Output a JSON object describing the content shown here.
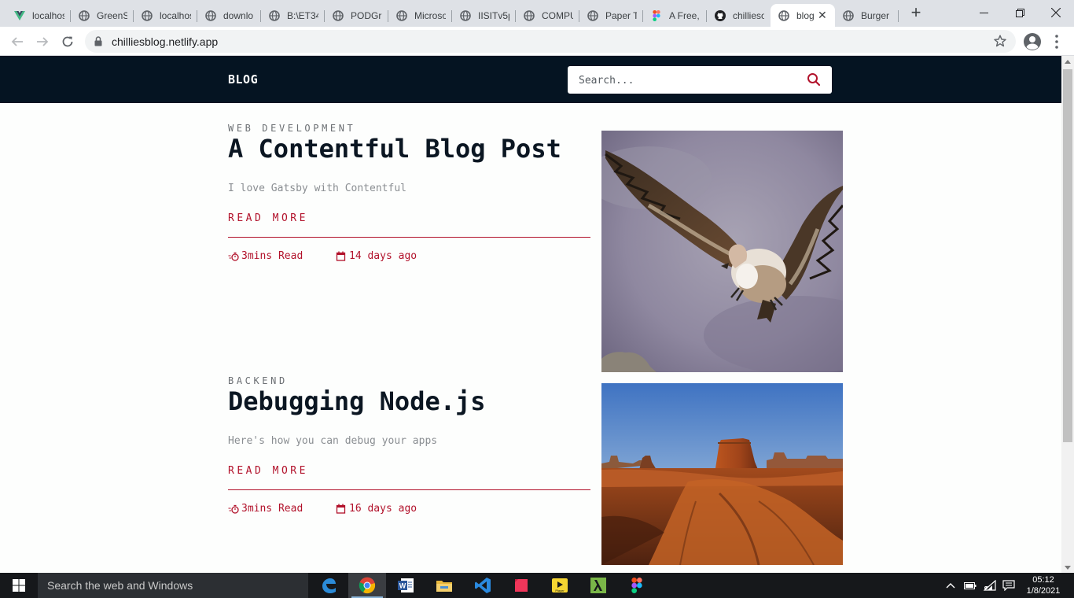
{
  "browser": {
    "tabs": [
      {
        "title": "localhos",
        "favicon": "vue-icon"
      },
      {
        "title": "GreenS",
        "favicon": "globe-icon"
      },
      {
        "title": "localhos",
        "favicon": "globe-icon"
      },
      {
        "title": "downlo",
        "favicon": "globe-icon"
      },
      {
        "title": "B:\\ET34",
        "favicon": "globe-icon"
      },
      {
        "title": "PODGr",
        "favicon": "globe-icon"
      },
      {
        "title": "Microso",
        "favicon": "globe-icon"
      },
      {
        "title": "IISITv5p",
        "favicon": "globe-icon"
      },
      {
        "title": "COMPU",
        "favicon": "globe-icon"
      },
      {
        "title": "Paper T",
        "favicon": "globe-icon"
      },
      {
        "title": "A Free,",
        "favicon": "figma-icon"
      },
      {
        "title": "chillieso",
        "favicon": "github-icon"
      },
      {
        "title": "blog",
        "favicon": "globe-icon",
        "active": true
      },
      {
        "title": "Burger",
        "favicon": "globe-icon"
      }
    ],
    "url": "chilliesblog.netlify.app"
  },
  "site": {
    "logo": "BLOG",
    "search_placeholder": "Search...",
    "accent_color": "#b2122b",
    "header_color": "#051422"
  },
  "posts": [
    {
      "category": "WEB DEVELOPMENT",
      "title": "A Contentful Blog Post",
      "excerpt": "I love Gatsby with Contentful",
      "read_more": "READ MORE",
      "read_time": "3mins Read",
      "date": "14 days ago",
      "image": "vulture-in-flight"
    },
    {
      "category": "BACKEND",
      "title": "Debugging Node.js",
      "excerpt": "Here's how you can debug your apps",
      "read_more": "READ MORE",
      "read_time": "3mins Read",
      "date": "16 days ago",
      "image": "desert-mesa"
    }
  ],
  "taskbar": {
    "search_placeholder": "Search the web and Windows",
    "apps": [
      "edge-icon",
      "chrome-icon",
      "word-icon",
      "file-explorer-icon",
      "vscode-icon",
      "app-icon",
      "media-player-icon",
      "lambda-icon",
      "figma-icon"
    ],
    "time": "05:12",
    "date": "1/8/2021"
  }
}
